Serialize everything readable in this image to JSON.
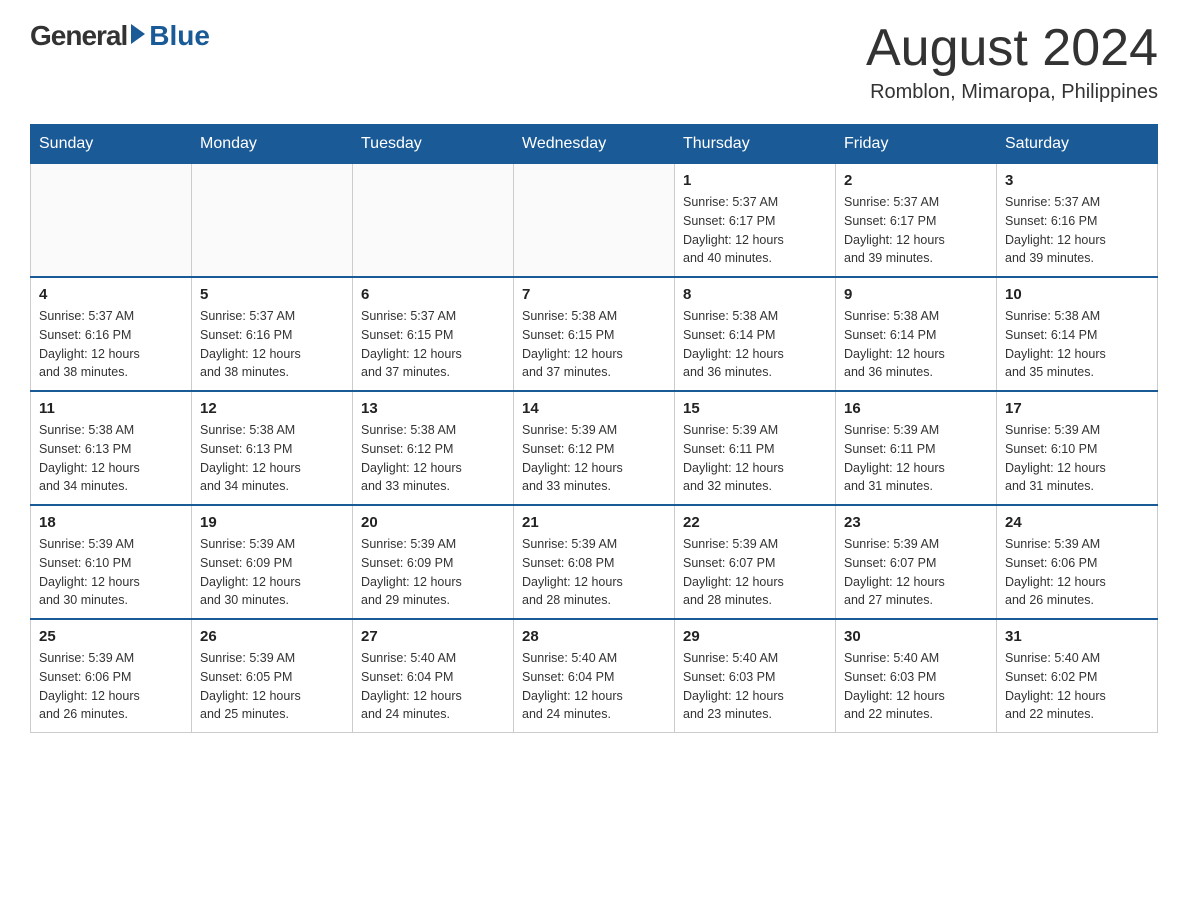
{
  "header": {
    "logo_general": "General",
    "logo_blue": "Blue",
    "month_title": "August 2024",
    "location": "Romblon, Mimaropa, Philippines"
  },
  "days_of_week": [
    "Sunday",
    "Monday",
    "Tuesday",
    "Wednesday",
    "Thursday",
    "Friday",
    "Saturday"
  ],
  "weeks": [
    [
      {
        "day": "",
        "info": ""
      },
      {
        "day": "",
        "info": ""
      },
      {
        "day": "",
        "info": ""
      },
      {
        "day": "",
        "info": ""
      },
      {
        "day": "1",
        "info": "Sunrise: 5:37 AM\nSunset: 6:17 PM\nDaylight: 12 hours\nand 40 minutes."
      },
      {
        "day": "2",
        "info": "Sunrise: 5:37 AM\nSunset: 6:17 PM\nDaylight: 12 hours\nand 39 minutes."
      },
      {
        "day": "3",
        "info": "Sunrise: 5:37 AM\nSunset: 6:16 PM\nDaylight: 12 hours\nand 39 minutes."
      }
    ],
    [
      {
        "day": "4",
        "info": "Sunrise: 5:37 AM\nSunset: 6:16 PM\nDaylight: 12 hours\nand 38 minutes."
      },
      {
        "day": "5",
        "info": "Sunrise: 5:37 AM\nSunset: 6:16 PM\nDaylight: 12 hours\nand 38 minutes."
      },
      {
        "day": "6",
        "info": "Sunrise: 5:37 AM\nSunset: 6:15 PM\nDaylight: 12 hours\nand 37 minutes."
      },
      {
        "day": "7",
        "info": "Sunrise: 5:38 AM\nSunset: 6:15 PM\nDaylight: 12 hours\nand 37 minutes."
      },
      {
        "day": "8",
        "info": "Sunrise: 5:38 AM\nSunset: 6:14 PM\nDaylight: 12 hours\nand 36 minutes."
      },
      {
        "day": "9",
        "info": "Sunrise: 5:38 AM\nSunset: 6:14 PM\nDaylight: 12 hours\nand 36 minutes."
      },
      {
        "day": "10",
        "info": "Sunrise: 5:38 AM\nSunset: 6:14 PM\nDaylight: 12 hours\nand 35 minutes."
      }
    ],
    [
      {
        "day": "11",
        "info": "Sunrise: 5:38 AM\nSunset: 6:13 PM\nDaylight: 12 hours\nand 34 minutes."
      },
      {
        "day": "12",
        "info": "Sunrise: 5:38 AM\nSunset: 6:13 PM\nDaylight: 12 hours\nand 34 minutes."
      },
      {
        "day": "13",
        "info": "Sunrise: 5:38 AM\nSunset: 6:12 PM\nDaylight: 12 hours\nand 33 minutes."
      },
      {
        "day": "14",
        "info": "Sunrise: 5:39 AM\nSunset: 6:12 PM\nDaylight: 12 hours\nand 33 minutes."
      },
      {
        "day": "15",
        "info": "Sunrise: 5:39 AM\nSunset: 6:11 PM\nDaylight: 12 hours\nand 32 minutes."
      },
      {
        "day": "16",
        "info": "Sunrise: 5:39 AM\nSunset: 6:11 PM\nDaylight: 12 hours\nand 31 minutes."
      },
      {
        "day": "17",
        "info": "Sunrise: 5:39 AM\nSunset: 6:10 PM\nDaylight: 12 hours\nand 31 minutes."
      }
    ],
    [
      {
        "day": "18",
        "info": "Sunrise: 5:39 AM\nSunset: 6:10 PM\nDaylight: 12 hours\nand 30 minutes."
      },
      {
        "day": "19",
        "info": "Sunrise: 5:39 AM\nSunset: 6:09 PM\nDaylight: 12 hours\nand 30 minutes."
      },
      {
        "day": "20",
        "info": "Sunrise: 5:39 AM\nSunset: 6:09 PM\nDaylight: 12 hours\nand 29 minutes."
      },
      {
        "day": "21",
        "info": "Sunrise: 5:39 AM\nSunset: 6:08 PM\nDaylight: 12 hours\nand 28 minutes."
      },
      {
        "day": "22",
        "info": "Sunrise: 5:39 AM\nSunset: 6:07 PM\nDaylight: 12 hours\nand 28 minutes."
      },
      {
        "day": "23",
        "info": "Sunrise: 5:39 AM\nSunset: 6:07 PM\nDaylight: 12 hours\nand 27 minutes."
      },
      {
        "day": "24",
        "info": "Sunrise: 5:39 AM\nSunset: 6:06 PM\nDaylight: 12 hours\nand 26 minutes."
      }
    ],
    [
      {
        "day": "25",
        "info": "Sunrise: 5:39 AM\nSunset: 6:06 PM\nDaylight: 12 hours\nand 26 minutes."
      },
      {
        "day": "26",
        "info": "Sunrise: 5:39 AM\nSunset: 6:05 PM\nDaylight: 12 hours\nand 25 minutes."
      },
      {
        "day": "27",
        "info": "Sunrise: 5:40 AM\nSunset: 6:04 PM\nDaylight: 12 hours\nand 24 minutes."
      },
      {
        "day": "28",
        "info": "Sunrise: 5:40 AM\nSunset: 6:04 PM\nDaylight: 12 hours\nand 24 minutes."
      },
      {
        "day": "29",
        "info": "Sunrise: 5:40 AM\nSunset: 6:03 PM\nDaylight: 12 hours\nand 23 minutes."
      },
      {
        "day": "30",
        "info": "Sunrise: 5:40 AM\nSunset: 6:03 PM\nDaylight: 12 hours\nand 22 minutes."
      },
      {
        "day": "31",
        "info": "Sunrise: 5:40 AM\nSunset: 6:02 PM\nDaylight: 12 hours\nand 22 minutes."
      }
    ]
  ]
}
